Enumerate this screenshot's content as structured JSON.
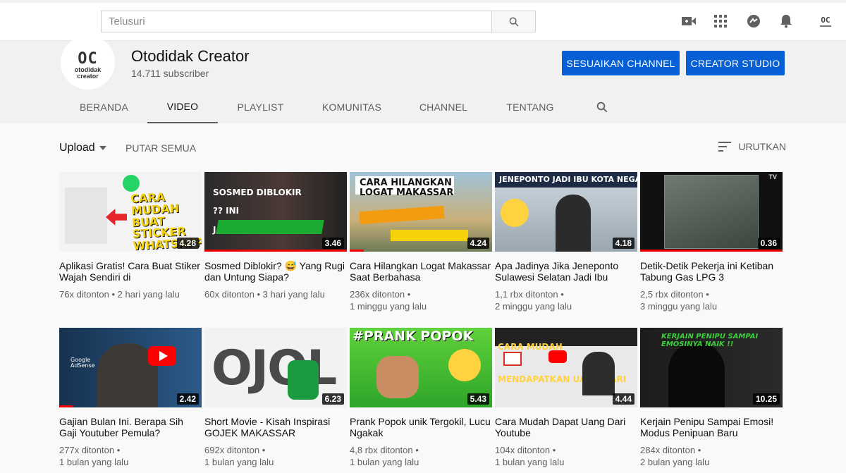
{
  "search": {
    "placeholder": "Telusuri"
  },
  "header_icons": [
    "video-camera-icon",
    "apps-grid-icon",
    "messages-icon",
    "notifications-bell-icon",
    "account-avatar-icon"
  ],
  "account_logo": "OC",
  "channel": {
    "avatar_big": "OC",
    "avatar_small": "otodidak\ncreator",
    "name": "Otodidak Creator",
    "subscribers": "14.711 subscriber",
    "customize_label": "SESUAIKAN CHANNEL",
    "studio_label": "CREATOR STUDIO"
  },
  "tabs": [
    "BERANDA",
    "VIDEO",
    "PLAYLIST",
    "KOMUNITAS",
    "CHANNEL",
    "TENTANG"
  ],
  "active_tab": "VIDEO",
  "toolbar": {
    "upload_label": "Upload",
    "play_all_label": "PUTAR SEMUA",
    "sort_label": "URUTKAN"
  },
  "colors": {
    "brand_blue": "#065fd4",
    "progress_red": "#e00000",
    "youtube_red": "#ff0000"
  },
  "videos": [
    {
      "thumb_text": "CARA MUDAH BUAT STICKER WHATSAPP",
      "duration": "4.28",
      "title": "Aplikasi Gratis! Cara Buat Stiker Wajah Sendiri di",
      "views": "76x ditonton",
      "age": "2 hari yang lalu"
    },
    {
      "thumb_text": "SOSMED DIBLOKIR ?? INI JAWABANNYA !!",
      "duration": "3.46",
      "title": "Sosmed Diblokir? 😅 Yang Rugi dan Untung Siapa?",
      "views": "60x ditonton",
      "age": "3 hari yang lalu"
    },
    {
      "thumb_text": "CARA HILANGKAN LOGAT MAKASSAR",
      "duration": "4.24",
      "title": "Cara Hilangkan Logat Makassar Saat Berbahasa",
      "views": "236x ditonton",
      "age": "1 minggu yang lalu"
    },
    {
      "thumb_text": "JENEPONTO JADI IBU KOTA NEGARA",
      "duration": "4.18",
      "title": "Apa Jadinya Jika Jeneponto Sulawesi Selatan Jadi Ibu",
      "views": "1,1 rbx ditonton",
      "age": "2 minggu yang lalu"
    },
    {
      "thumb_text": "",
      "duration": "0.36",
      "title": "Detik-Detik Pekerja ini Ketiban Tabung Gas LPG 3",
      "views": "2,5 rbx ditonton",
      "age": "3 minggu yang lalu"
    },
    {
      "thumb_text": "Google AdSense",
      "duration": "2.42",
      "title": "Gajian Bulan Ini. Berapa Sih Gaji Youtuber Pemula?",
      "views": "277x ditonton",
      "age": "1 bulan yang lalu"
    },
    {
      "thumb_text": "OJOL",
      "duration": "6.23",
      "title": "Short Movie - Kisah Inspirasi GOJEK MAKASSAR",
      "views": "692x ditonton",
      "age": "1 bulan yang lalu"
    },
    {
      "thumb_text": "#PRANK POPOK",
      "duration": "5.43",
      "title": "Prank Popok unik Tergokil, Lucu Ngakak",
      "views": "4,8 rbx ditonton",
      "age": "1 bulan yang lalu"
    },
    {
      "thumb_text": "CARA MUDAH MENDAPATKAN UANG DARI YOUTUBE",
      "duration": "4.44",
      "title": "Cara Mudah Dapat Uang Dari Youtube",
      "views": "104x ditonton",
      "age": "1 bulan yang lalu"
    },
    {
      "thumb_text": "KERJAIN PENIPU SAMPAI EMOSINYA NAIK !!",
      "duration": "10.25",
      "title": "Kerjain Penipu Sampai Emosi! Modus Penipuan Baru",
      "views": "284x ditonton",
      "age": "2 bulan yang lalu"
    }
  ]
}
